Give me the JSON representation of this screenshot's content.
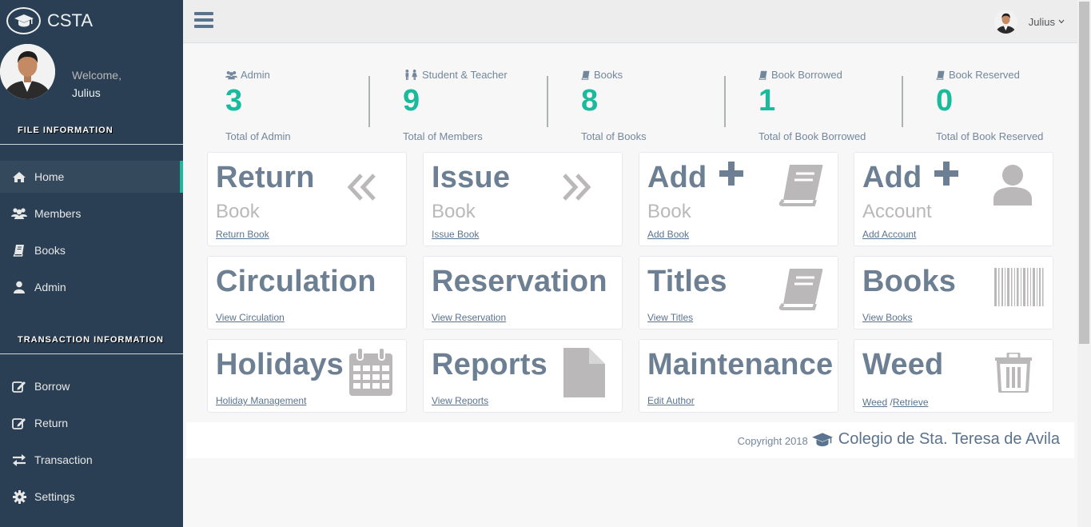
{
  "brand": {
    "title": "CSTA",
    "logo_icon": "graduation-cap-icon"
  },
  "profile": {
    "welcome": "Welcome,",
    "name": "Julius"
  },
  "sidebar": {
    "file_section": "FILE INFORMATION",
    "file_items": [
      {
        "label": "Home",
        "icon": "home-icon",
        "active": true
      },
      {
        "label": "Members",
        "icon": "users-icon"
      },
      {
        "label": "Books",
        "icon": "book-icon"
      },
      {
        "label": "Admin",
        "icon": "user-icon"
      }
    ],
    "transaction_section": "TRANSACTION INFORMATION",
    "transaction_items": [
      {
        "label": "Borrow",
        "icon": "edit-icon"
      },
      {
        "label": "Return",
        "icon": "edit-icon"
      },
      {
        "label": "Transaction",
        "icon": "exchange-icon"
      },
      {
        "label": "Settings",
        "icon": "gear-icon"
      }
    ]
  },
  "topnav": {
    "user_name": "Julius"
  },
  "stats": [
    {
      "label": "Admin",
      "count": "3",
      "sub": "Total of Admin",
      "icon": "users-icon"
    },
    {
      "label": "Student & Teacher",
      "count": "9",
      "sub": "Total of Members",
      "icon": "male-female-icon"
    },
    {
      "label": "Books",
      "count": "8",
      "sub": "Total of Books",
      "icon": "book-icon"
    },
    {
      "label": "Book Borrowed",
      "count": "1",
      "sub": "Total of Book Borrowed",
      "icon": "book-icon"
    },
    {
      "label": "Book Reserved",
      "count": "0",
      "sub": "Total of Book Reserved",
      "icon": "book-icon"
    }
  ],
  "tiles": {
    "return": {
      "title": "Return",
      "sub": "Book",
      "link": "Return Book"
    },
    "issue": {
      "title": "Issue",
      "sub": "Book",
      "link": "Issue Book"
    },
    "add_book": {
      "title": "Add",
      "sub": "Book",
      "link": "Add Book"
    },
    "add_account": {
      "title": "Add",
      "sub": "Account",
      "link": "Add Account"
    },
    "circulation": {
      "title": "Circulation",
      "link": "View Circulation"
    },
    "reservation": {
      "title": "Reservation",
      "link": "View Reservation"
    },
    "titles": {
      "title": "Titles",
      "link": "View Titles"
    },
    "books": {
      "title": "Books",
      "link": "View Books"
    },
    "holidays": {
      "title": "Holidays",
      "link": "Holiday Management"
    },
    "reports": {
      "title": "Reports",
      "link": "View Reports"
    },
    "maintenance": {
      "title": "Maintenance",
      "link": "Edit Author"
    },
    "weed": {
      "title": "Weed",
      "link": "Weed",
      "separator": " /",
      "link2": "Retrieve"
    }
  },
  "footer": {
    "copyright": "Copyright 2018",
    "school": "Colegio de Sta. Teresa de Avila"
  },
  "colors": {
    "sidebar": "#2A3F54",
    "accent": "#1ABB9C",
    "tile_title": "#6D7F93",
    "icon_gray": "#BAB8B8"
  }
}
